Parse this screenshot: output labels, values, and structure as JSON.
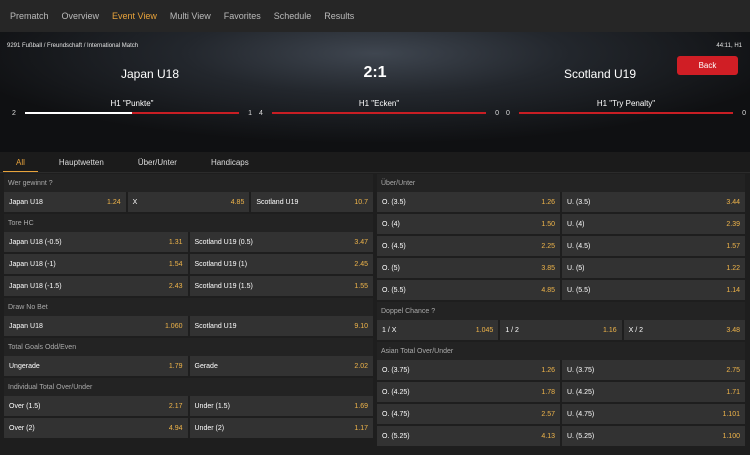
{
  "nav": {
    "items": [
      "Prematch",
      "Overview",
      "Event View",
      "Multi View",
      "Favorites",
      "Schedule",
      "Results"
    ],
    "active_index": 2
  },
  "match": {
    "breadcrumb": "9291 Fußball / Freundschaft / International Match",
    "time": "44:11, H1",
    "home": "Japan U18",
    "away": "Scotland U19",
    "score": "2:1",
    "back_label": "Back"
  },
  "stats": [
    {
      "title": "H1 \"Punkte\"",
      "left": "2",
      "right": "1",
      "fill_fraction": 0.5
    },
    {
      "title": "H1 \"Ecken\"",
      "left": "4",
      "right": "0",
      "fill_fraction": 0.0
    },
    {
      "title": "H1 \"Try Penalty\"",
      "left": "0",
      "right": "0",
      "fill_fraction": 0.0
    }
  ],
  "tabs": [
    "All",
    "Hauptwetten",
    "Über/Unter",
    "Handicaps"
  ],
  "colors": {
    "accent": "#e8a33b",
    "odds": "#f0b54a",
    "danger": "#d01e25"
  },
  "left_markets": {
    "winner": {
      "title": "Wer gewinnt ?",
      "rows": [
        [
          [
            "Japan U18",
            "1.24"
          ],
          [
            "X",
            "4.85"
          ],
          [
            "Scotland U19",
            "10.7"
          ]
        ]
      ]
    },
    "tore_hc": {
      "title": "Tore HC",
      "rows": [
        [
          [
            "Japan U18 (-0.5)",
            "1.31"
          ],
          [
            "Scotland U19 (0.5)",
            "3.47"
          ]
        ],
        [
          [
            "Japan U18 (-1)",
            "1.54"
          ],
          [
            "Scotland U19 (1)",
            "2.45"
          ]
        ],
        [
          [
            "Japan U18 (-1.5)",
            "2.43"
          ],
          [
            "Scotland U19 (1.5)",
            "1.55"
          ]
        ]
      ]
    },
    "draw_no_bet": {
      "title": "Draw No Bet",
      "rows": [
        [
          [
            "Japan U18",
            "1.060"
          ],
          [
            "Scotland U19",
            "9.10"
          ]
        ]
      ]
    },
    "odd_even": {
      "title": "Total Goals Odd/Even",
      "rows": [
        [
          [
            "Ungerade",
            "1.79"
          ],
          [
            "Gerade",
            "2.02"
          ]
        ]
      ]
    },
    "individual": {
      "title": "Individual Total Over/Under",
      "rows": [
        [
          [
            "Over (1.5)",
            "2.17"
          ],
          [
            "Under (1.5)",
            "1.69"
          ]
        ],
        [
          [
            "Over (2)",
            "4.94"
          ],
          [
            "Under (2)",
            "1.17"
          ]
        ]
      ]
    }
  },
  "right_markets": {
    "over_under": {
      "title": "Über/Unter",
      "rows": [
        [
          [
            "O. (3.5)",
            "1.26"
          ],
          [
            "U. (3.5)",
            "3.44"
          ]
        ],
        [
          [
            "O. (4)",
            "1.50"
          ],
          [
            "U. (4)",
            "2.39"
          ]
        ],
        [
          [
            "O. (4.5)",
            "2.25"
          ],
          [
            "U. (4.5)",
            "1.57"
          ]
        ],
        [
          [
            "O. (5)",
            "3.85"
          ],
          [
            "U. (5)",
            "1.22"
          ]
        ],
        [
          [
            "O. (5.5)",
            "4.85"
          ],
          [
            "U. (5.5)",
            "1.14"
          ]
        ]
      ]
    },
    "double_chance": {
      "title": "Doppel Chance ?",
      "rows": [
        [
          [
            "1 / X",
            "1.045"
          ],
          [
            "1 / 2",
            "1.16"
          ],
          [
            "X / 2",
            "3.48"
          ]
        ]
      ]
    },
    "asian_total": {
      "title": "Asian Total Over/Under",
      "rows": [
        [
          [
            "O. (3.75)",
            "1.26"
          ],
          [
            "U. (3.75)",
            "2.75"
          ]
        ],
        [
          [
            "O. (4.25)",
            "1.78"
          ],
          [
            "U. (4.25)",
            "1.71"
          ]
        ],
        [
          [
            "O. (4.75)",
            "2.57"
          ],
          [
            "U. (4.75)",
            "1.101"
          ]
        ],
        [
          [
            "O. (5.25)",
            "4.13"
          ],
          [
            "U. (5.25)",
            "1.100"
          ]
        ]
      ]
    }
  }
}
